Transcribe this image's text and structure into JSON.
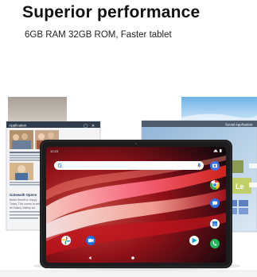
{
  "product": {
    "headline": "Superior performance",
    "spec_line": "6GB RAM 32GB ROM, Faster tablet"
  },
  "left_window": {
    "title": "Application",
    "article_title": "Gatewalk Opens",
    "body_lines": [
      "Better Sheriff or Happy",
      "Today, This comes to write",
      "all Gallery Gallery art"
    ],
    "controls": [
      "_",
      "□",
      "✕"
    ]
  },
  "right_window": {
    "title": "Social Application"
  },
  "tablet": {
    "status_time": "12:23",
    "search": {
      "provider_letter": "G"
    },
    "icons": [
      "camera-icon",
      "chrome-icon",
      "messages-icon",
      "calendar-icon",
      "phone-icon",
      "play-store-icon",
      "photos-icon",
      "duo-icon"
    ],
    "nav": [
      "back-icon",
      "home-icon"
    ]
  },
  "colors": {
    "bezel": "#1c1c1e",
    "wallpaper_base": "#0a0a12",
    "wave_red": "#e2261d",
    "wave_pink": "#ff6f87",
    "wave_white": "#ffe9e4"
  }
}
